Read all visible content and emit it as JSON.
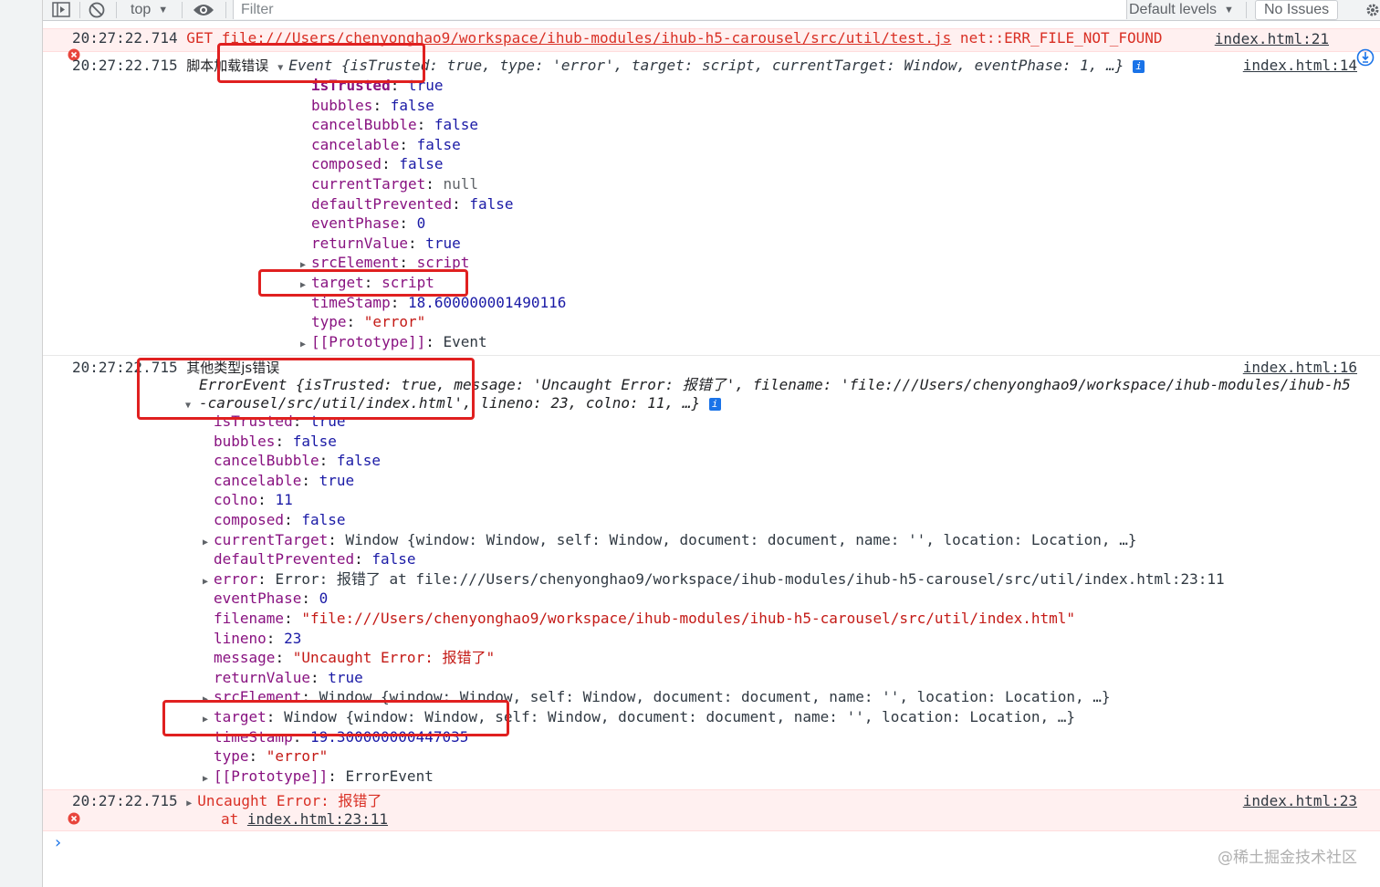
{
  "toolbar": {
    "context": "top",
    "filter_placeholder": "Filter",
    "levels": "Default levels",
    "issues": "No Issues"
  },
  "row1": {
    "ts": "20:27:22.714",
    "text": "GET ",
    "url": "file:///Users/chenyonghao9/workspace/ihub-modules/ihub-h5-carousel/src/util/test.js",
    "err": " net::ERR_FILE_NOT_FOUND",
    "link": "index.html:21"
  },
  "row2": {
    "ts": "20:27:22.715",
    "label": "脚本加载错误",
    "header": "Event {isTrusted: true, type: 'error', target: script, currentTarget: Window, eventPhase: 1, …}",
    "link": "index.html:14",
    "props": [
      {
        "k": "isTrusted",
        "v": "true",
        "t": "kw",
        "bold": true
      },
      {
        "k": "bubbles",
        "v": "false",
        "t": "kw"
      },
      {
        "k": "cancelBubble",
        "v": "false",
        "t": "kw"
      },
      {
        "k": "cancelable",
        "v": "false",
        "t": "kw"
      },
      {
        "k": "composed",
        "v": "false",
        "t": "kw"
      },
      {
        "k": "currentTarget",
        "v": "null",
        "t": "grey"
      },
      {
        "k": "defaultPrevented",
        "v": "false",
        "t": "kw"
      },
      {
        "k": "eventPhase",
        "v": "0",
        "t": "num"
      },
      {
        "k": "returnValue",
        "v": "true",
        "t": "kw"
      },
      {
        "k": "srcElement",
        "v": "script",
        "t": "key",
        "expand": true
      },
      {
        "k": "target",
        "v": "script",
        "t": "key",
        "expand": true
      },
      {
        "k": "timeStamp",
        "v": "18.600000001490116",
        "t": "num"
      },
      {
        "k": "type",
        "v": "\"error\"",
        "t": "str"
      },
      {
        "k": "[[Prototype]]",
        "v": "Event",
        "t": "obj",
        "expand": true
      }
    ]
  },
  "row3": {
    "ts": "20:27:22.715",
    "label": "其他类型js错误",
    "header1": "ErrorEvent {isTrusted: true, message: 'Uncaught Error: 报错了', filename: 'file:///Users/chenyonghao9/workspace/ihub-modules/ihub-h5",
    "header2": "-carousel/src/util/index.html', lineno: 23, colno: 11, …}",
    "link": "index.html:16",
    "props": [
      {
        "k": "isTrusted",
        "v": "true",
        "t": "kw"
      },
      {
        "k": "bubbles",
        "v": "false",
        "t": "kw"
      },
      {
        "k": "cancelBubble",
        "v": "false",
        "t": "kw"
      },
      {
        "k": "cancelable",
        "v": "true",
        "t": "kw"
      },
      {
        "k": "colno",
        "v": "11",
        "t": "num"
      },
      {
        "k": "composed",
        "v": "false",
        "t": "kw"
      },
      {
        "k": "currentTarget",
        "v": "Window {window: Window, self: Window, document: document, name: '', location: Location, …}",
        "t": "obj",
        "expand": true
      },
      {
        "k": "defaultPrevented",
        "v": "false",
        "t": "kw"
      },
      {
        "k": "error",
        "v": "Error: 报错了 at file:///Users/chenyonghao9/workspace/ihub-modules/ihub-h5-carousel/src/util/index.html:23:11",
        "t": "obj",
        "expand": true
      },
      {
        "k": "eventPhase",
        "v": "0",
        "t": "num"
      },
      {
        "k": "filename",
        "v": "\"file:///Users/chenyonghao9/workspace/ihub-modules/ihub-h5-carousel/src/util/index.html\"",
        "t": "str"
      },
      {
        "k": "lineno",
        "v": "23",
        "t": "num"
      },
      {
        "k": "message",
        "v": "\"Uncaught Error: 报错了\"",
        "t": "str"
      },
      {
        "k": "returnValue",
        "v": "true",
        "t": "kw"
      },
      {
        "k": "srcElement",
        "v": "Window {window: Window, self: Window, document: document, name: '', location: Location, …}",
        "t": "obj",
        "expand": true
      },
      {
        "k": "target",
        "v": "Window {window: Window, self: Window, document: document, name: '', location: Location, …}",
        "t": "obj",
        "expand": true
      },
      {
        "k": "timeStamp",
        "v": "19.300000000447035",
        "t": "num"
      },
      {
        "k": "type",
        "v": "\"error\"",
        "t": "str"
      },
      {
        "k": "[[Prototype]]",
        "v": "ErrorEvent",
        "t": "obj",
        "expand": true
      }
    ]
  },
  "row4": {
    "ts": "20:27:22.715",
    "err": "Uncaught Error: 报错了",
    "at": "at ",
    "atlink": "index.html:23:11",
    "link": "index.html:23"
  },
  "prompt": "›",
  "watermark": "@稀土掘金技术社区",
  "colors": {
    "error_bg": "#fff0f0",
    "error_text": "#d93025",
    "highlight": "#e02020"
  }
}
